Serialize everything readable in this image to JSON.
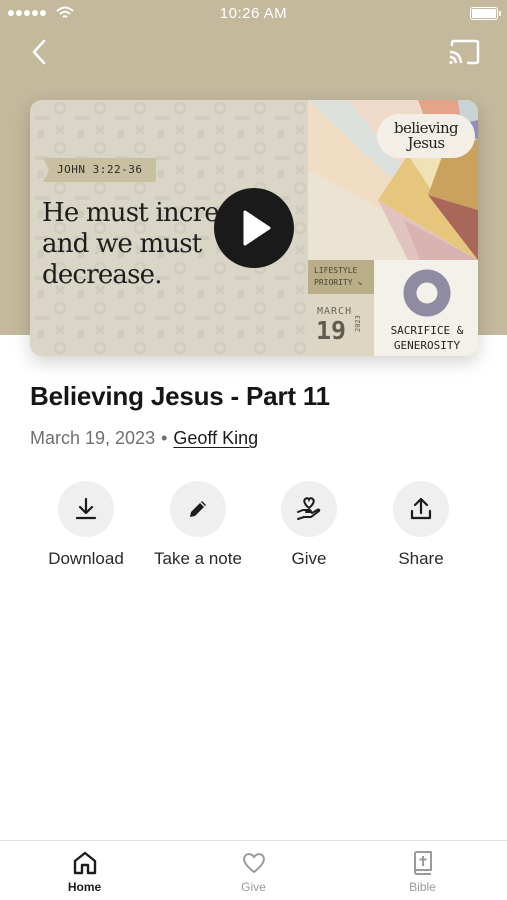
{
  "status_bar": {
    "time": "10:26 AM"
  },
  "video": {
    "verse_ref": "JOHN 3:22-36",
    "headline_lines": [
      "He must increase",
      "and we must",
      "decrease."
    ],
    "series_logo_lines": [
      "believing",
      "Jesus"
    ],
    "lifestyle_tag_lines": [
      "LIFESTYLE",
      "PRIORITY ↘"
    ],
    "date_month": "MARCH",
    "date_day": "19",
    "date_year": "2023",
    "topic_lines": [
      "SACRIFICE &",
      "GENEROSITY"
    ]
  },
  "sermon": {
    "title": "Believing Jesus - Part 11",
    "date": "March 19, 2023",
    "separator": "•",
    "speaker": "Geoff King"
  },
  "actions": [
    {
      "label": "Download",
      "icon": "download-icon"
    },
    {
      "label": "Take a note",
      "icon": "pencil-icon"
    },
    {
      "label": "Give",
      "icon": "hand-heart-icon"
    },
    {
      "label": "Share",
      "icon": "share-icon"
    }
  ],
  "tabs": [
    {
      "label": "Home",
      "icon": "home-icon",
      "active": true
    },
    {
      "label": "Give",
      "icon": "heart-icon",
      "active": false
    },
    {
      "label": "Bible",
      "icon": "bible-icon",
      "active": false
    }
  ],
  "colors": {
    "hero_background": "#c4b99d",
    "accent_ring": "#8f8ba3",
    "active_tab": "#1c1c1c",
    "inactive_tab": "#9a9a9a"
  }
}
